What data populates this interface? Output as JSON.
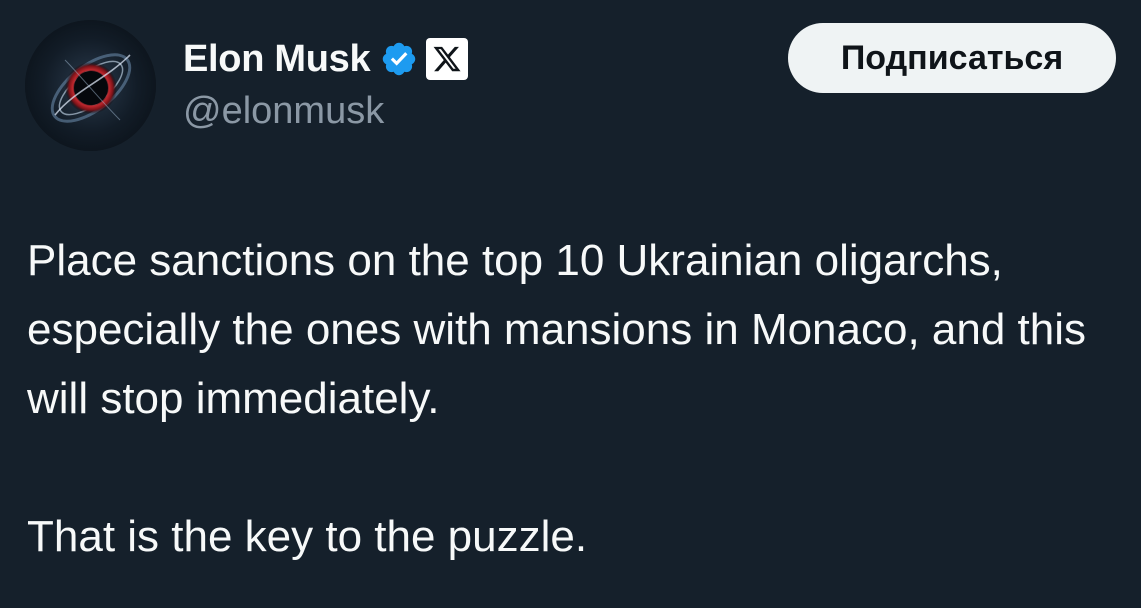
{
  "author": {
    "display_name": "Elon Musk",
    "handle": "@elonmusk",
    "verified": true,
    "affiliate_badge": "x-logo-icon",
    "avatar": "black-hole-avatar"
  },
  "actions": {
    "subscribe_label": "Подписаться"
  },
  "tweet": {
    "paragraph_1": "Place sanctions on the top 10 Ukrainian oligarchs, especially the ones with mansions in Monaco, and this will stop immediately.",
    "paragraph_2": "That is the key to the puzzle."
  },
  "colors": {
    "background": "#15202b",
    "text_primary": "#f7f9f9",
    "text_secondary": "#8b98a5",
    "verified_blue": "#1d9bf0",
    "button_bg": "#eff3f4",
    "button_text": "#0f1419"
  }
}
